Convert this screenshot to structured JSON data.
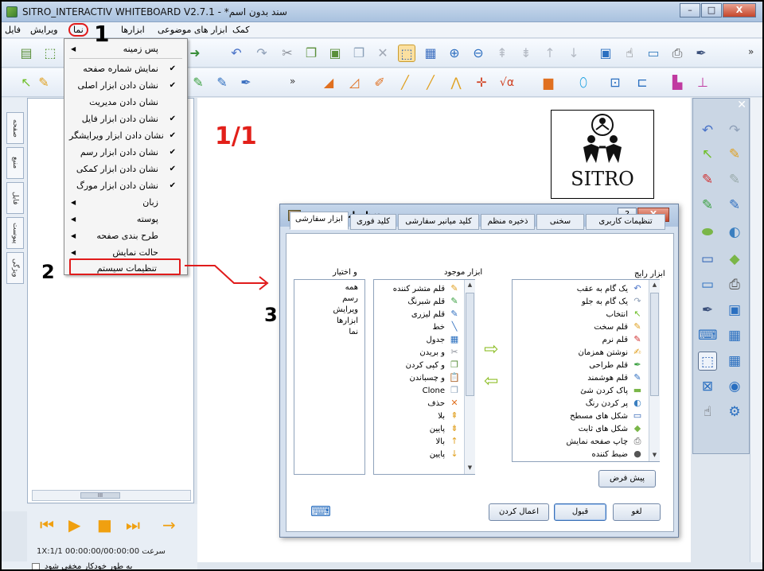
{
  "window": {
    "title": "SITRO_INTERACTIV WHITEBOARD V2.7.1 - *سند بدون اسم",
    "buttons": [
      "–",
      "□",
      "X"
    ]
  },
  "menubar": {
    "items": [
      "فایل",
      "ویرایش",
      "نما",
      "ابزارها",
      "ابزار های موضوعی",
      "کمک"
    ]
  },
  "view_menu": {
    "items": [
      {
        "label": "پس زمینه",
        "checked": false,
        "submenu": true
      },
      {
        "label": "نمایش شماره صفحه",
        "checked": true,
        "submenu": false
      },
      {
        "label": "نشان دادن ابزار اصلی",
        "checked": true,
        "submenu": false
      },
      {
        "label": "نشان دادن مدیریت",
        "checked": false,
        "submenu": false
      },
      {
        "label": "نشان دادن ابزار فایل",
        "checked": true,
        "submenu": false
      },
      {
        "label": "نشان دادن ابزار ویرایشگر",
        "checked": true,
        "submenu": false
      },
      {
        "label": "نشان دادن ابزار رسم",
        "checked": true,
        "submenu": false
      },
      {
        "label": "نشان دادن ابزار کمکی",
        "checked": true,
        "submenu": false
      },
      {
        "label": "نشان دادن ابزار مورگ",
        "checked": true,
        "submenu": false
      },
      {
        "label": "زبان",
        "checked": false,
        "submenu": true
      },
      {
        "label": "پوسته",
        "checked": false,
        "submenu": true
      },
      {
        "label": "طرح بندی صفحه",
        "checked": false,
        "submenu": true
      },
      {
        "label": "حالت نمایش",
        "checked": false,
        "submenu": true
      },
      {
        "label": "تنظیمات سیستم",
        "checked": false,
        "submenu": false
      }
    ]
  },
  "left_tabs": [
    "صفحه",
    "منبع",
    "فایل",
    "پیوست",
    "ویژگی"
  ],
  "left_panel": {
    "hscroll_label": "III",
    "timeline": "1X:سرعت   00:00:00/00:00:00   1/1",
    "autohide": "به طور خودکار مخفی شود"
  },
  "canvas": {
    "page_number": "1/1",
    "logo_text": "SITRO"
  },
  "annotations": [
    "1",
    "2",
    "3"
  ],
  "dialog": {
    "title": "تنظیمات سیستم",
    "help": "?",
    "close": "X",
    "tabs": [
      "ابزار سفارشی",
      "کلید فوری",
      "کلید میانبر سفارشی",
      "ذخیره منظم",
      "سخنی",
      "تنظیمات کاربری"
    ],
    "col_right_label": "ابزار رایج",
    "col_mid_label": "ابزار موجود",
    "col_left_label": "و اختیار",
    "common_tools": [
      {
        "label": "یک گام به عقب",
        "icon": "↶"
      },
      {
        "label": "یک گام به جلو",
        "icon": "↷"
      },
      {
        "label": "انتخاب",
        "icon": "↖"
      },
      {
        "label": "قلم سخت",
        "icon": "✎"
      },
      {
        "label": "قلم نرم",
        "icon": "✎"
      },
      {
        "label": "نوشتن همزمان",
        "icon": "✍"
      },
      {
        "label": "قلم طراحی",
        "icon": "✒"
      },
      {
        "label": "قلم هوشمند",
        "icon": "✎"
      },
      {
        "label": "پاک کردن شئ",
        "icon": "▬"
      },
      {
        "label": "پر کردن رنگ",
        "icon": "◐"
      },
      {
        "label": "شکل های مسطح",
        "icon": "▭"
      },
      {
        "label": "شکل های ثابت",
        "icon": "◆"
      },
      {
        "label": "چاپ صفحه نمایش",
        "icon": "⎙"
      },
      {
        "label": "ضبط کننده",
        "icon": "●"
      }
    ],
    "available_tools": [
      {
        "label": "قلم متشر کننده",
        "icon": "✎"
      },
      {
        "label": "قلم شبرنگ",
        "icon": "✎"
      },
      {
        "label": "قلم لیزری",
        "icon": "✎"
      },
      {
        "label": "خط",
        "icon": "╲"
      },
      {
        "label": "جدول",
        "icon": "▦"
      },
      {
        "label": "و بریدن",
        "icon": "✂"
      },
      {
        "label": "و کپی کردن",
        "icon": "❐"
      },
      {
        "label": "و چسباندن",
        "icon": "📋"
      },
      {
        "label": "Clone",
        "icon": "❐"
      },
      {
        "label": "حذف",
        "icon": "✕"
      },
      {
        "label": "بلا",
        "icon": "⇞"
      },
      {
        "label": "پایین",
        "icon": "⇟"
      },
      {
        "label": "بالا",
        "icon": "↑"
      },
      {
        "label": "پایین",
        "icon": "↓"
      }
    ],
    "categories": [
      "همه",
      "رسم",
      "ویرایش",
      "ابزارها",
      "نما"
    ],
    "default_button": "پیش فرض",
    "buttons": {
      "cancel": "لغو",
      "ok": "قبول",
      "apply": "اعمال کردن"
    }
  },
  "colors": {
    "accent_red": "#e01b1b",
    "title_bar": "#b5cae4",
    "page_number": "#e2201a"
  }
}
